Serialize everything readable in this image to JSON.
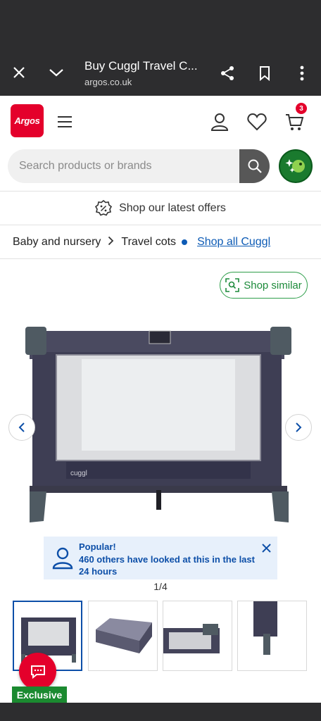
{
  "browser": {
    "tab_title": "Buy Cuggl Travel C...",
    "url": "argos.co.uk",
    "icons": [
      "close-icon",
      "chevron-down-icon",
      "share-icon",
      "bookmark-icon",
      "more-vert-icon"
    ]
  },
  "header": {
    "logo_text": "Argos",
    "cart_count": "3",
    "search_placeholder": "Search products or brands",
    "icons": [
      "menu-icon",
      "account-icon",
      "heart-icon",
      "cart-icon",
      "search-icon",
      "sparkle-assistant-icon"
    ]
  },
  "offers": {
    "label": "Shop our latest offers",
    "icon": "discount-badge-icon"
  },
  "breadcrumb": {
    "items": [
      "Baby and nursery",
      "Travel cots"
    ],
    "link": "Shop all Cuggl"
  },
  "product": {
    "shop_similar": "Shop similar",
    "brand_on_image": "cuggl",
    "popular_title": "Popular!",
    "popular_text": "460 others have looked at this in the last 24 hours",
    "image_counter": "1/4",
    "thumbnail_count": 4,
    "selected_thumbnail": 1,
    "exclusive_label": "Exclusive"
  },
  "colors": {
    "brand_red": "#e4002b",
    "link_blue": "#0d5bb5",
    "accent_green": "#1b8a30",
    "chrome_dark": "#2d2d2f",
    "popular_bg": "#e7f0fb"
  }
}
